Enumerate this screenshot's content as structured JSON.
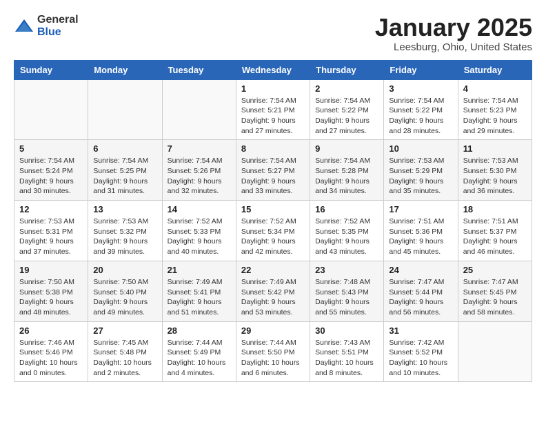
{
  "header": {
    "logo_general": "General",
    "logo_blue": "Blue",
    "month": "January 2025",
    "location": "Leesburg, Ohio, United States"
  },
  "weekdays": [
    "Sunday",
    "Monday",
    "Tuesday",
    "Wednesday",
    "Thursday",
    "Friday",
    "Saturday"
  ],
  "weeks": [
    [
      {
        "day": "",
        "info": ""
      },
      {
        "day": "",
        "info": ""
      },
      {
        "day": "",
        "info": ""
      },
      {
        "day": "1",
        "info": "Sunrise: 7:54 AM\nSunset: 5:21 PM\nDaylight: 9 hours\nand 27 minutes."
      },
      {
        "day": "2",
        "info": "Sunrise: 7:54 AM\nSunset: 5:22 PM\nDaylight: 9 hours\nand 27 minutes."
      },
      {
        "day": "3",
        "info": "Sunrise: 7:54 AM\nSunset: 5:22 PM\nDaylight: 9 hours\nand 28 minutes."
      },
      {
        "day": "4",
        "info": "Sunrise: 7:54 AM\nSunset: 5:23 PM\nDaylight: 9 hours\nand 29 minutes."
      }
    ],
    [
      {
        "day": "5",
        "info": "Sunrise: 7:54 AM\nSunset: 5:24 PM\nDaylight: 9 hours\nand 30 minutes."
      },
      {
        "day": "6",
        "info": "Sunrise: 7:54 AM\nSunset: 5:25 PM\nDaylight: 9 hours\nand 31 minutes."
      },
      {
        "day": "7",
        "info": "Sunrise: 7:54 AM\nSunset: 5:26 PM\nDaylight: 9 hours\nand 32 minutes."
      },
      {
        "day": "8",
        "info": "Sunrise: 7:54 AM\nSunset: 5:27 PM\nDaylight: 9 hours\nand 33 minutes."
      },
      {
        "day": "9",
        "info": "Sunrise: 7:54 AM\nSunset: 5:28 PM\nDaylight: 9 hours\nand 34 minutes."
      },
      {
        "day": "10",
        "info": "Sunrise: 7:53 AM\nSunset: 5:29 PM\nDaylight: 9 hours\nand 35 minutes."
      },
      {
        "day": "11",
        "info": "Sunrise: 7:53 AM\nSunset: 5:30 PM\nDaylight: 9 hours\nand 36 minutes."
      }
    ],
    [
      {
        "day": "12",
        "info": "Sunrise: 7:53 AM\nSunset: 5:31 PM\nDaylight: 9 hours\nand 37 minutes."
      },
      {
        "day": "13",
        "info": "Sunrise: 7:53 AM\nSunset: 5:32 PM\nDaylight: 9 hours\nand 39 minutes."
      },
      {
        "day": "14",
        "info": "Sunrise: 7:52 AM\nSunset: 5:33 PM\nDaylight: 9 hours\nand 40 minutes."
      },
      {
        "day": "15",
        "info": "Sunrise: 7:52 AM\nSunset: 5:34 PM\nDaylight: 9 hours\nand 42 minutes."
      },
      {
        "day": "16",
        "info": "Sunrise: 7:52 AM\nSunset: 5:35 PM\nDaylight: 9 hours\nand 43 minutes."
      },
      {
        "day": "17",
        "info": "Sunrise: 7:51 AM\nSunset: 5:36 PM\nDaylight: 9 hours\nand 45 minutes."
      },
      {
        "day": "18",
        "info": "Sunrise: 7:51 AM\nSunset: 5:37 PM\nDaylight: 9 hours\nand 46 minutes."
      }
    ],
    [
      {
        "day": "19",
        "info": "Sunrise: 7:50 AM\nSunset: 5:38 PM\nDaylight: 9 hours\nand 48 minutes."
      },
      {
        "day": "20",
        "info": "Sunrise: 7:50 AM\nSunset: 5:40 PM\nDaylight: 9 hours\nand 49 minutes."
      },
      {
        "day": "21",
        "info": "Sunrise: 7:49 AM\nSunset: 5:41 PM\nDaylight: 9 hours\nand 51 minutes."
      },
      {
        "day": "22",
        "info": "Sunrise: 7:49 AM\nSunset: 5:42 PM\nDaylight: 9 hours\nand 53 minutes."
      },
      {
        "day": "23",
        "info": "Sunrise: 7:48 AM\nSunset: 5:43 PM\nDaylight: 9 hours\nand 55 minutes."
      },
      {
        "day": "24",
        "info": "Sunrise: 7:47 AM\nSunset: 5:44 PM\nDaylight: 9 hours\nand 56 minutes."
      },
      {
        "day": "25",
        "info": "Sunrise: 7:47 AM\nSunset: 5:45 PM\nDaylight: 9 hours\nand 58 minutes."
      }
    ],
    [
      {
        "day": "26",
        "info": "Sunrise: 7:46 AM\nSunset: 5:46 PM\nDaylight: 10 hours\nand 0 minutes."
      },
      {
        "day": "27",
        "info": "Sunrise: 7:45 AM\nSunset: 5:48 PM\nDaylight: 10 hours\nand 2 minutes."
      },
      {
        "day": "28",
        "info": "Sunrise: 7:44 AM\nSunset: 5:49 PM\nDaylight: 10 hours\nand 4 minutes."
      },
      {
        "day": "29",
        "info": "Sunrise: 7:44 AM\nSunset: 5:50 PM\nDaylight: 10 hours\nand 6 minutes."
      },
      {
        "day": "30",
        "info": "Sunrise: 7:43 AM\nSunset: 5:51 PM\nDaylight: 10 hours\nand 8 minutes."
      },
      {
        "day": "31",
        "info": "Sunrise: 7:42 AM\nSunset: 5:52 PM\nDaylight: 10 hours\nand 10 minutes."
      },
      {
        "day": "",
        "info": ""
      }
    ]
  ]
}
